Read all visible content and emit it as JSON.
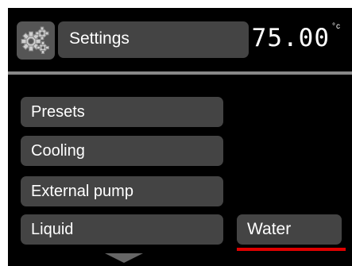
{
  "header": {
    "title": "Settings",
    "temperature": "75.00",
    "temperature_unit": "°c",
    "icon": "gears-icon"
  },
  "menu": {
    "items": [
      {
        "label": "Presets"
      },
      {
        "label": "Cooling"
      },
      {
        "label": "External pump"
      },
      {
        "label": "Liquid"
      }
    ]
  },
  "selection": {
    "value": "Water",
    "underline_color": "#e00000"
  },
  "scroll_icon": "triangle-down-icon"
}
